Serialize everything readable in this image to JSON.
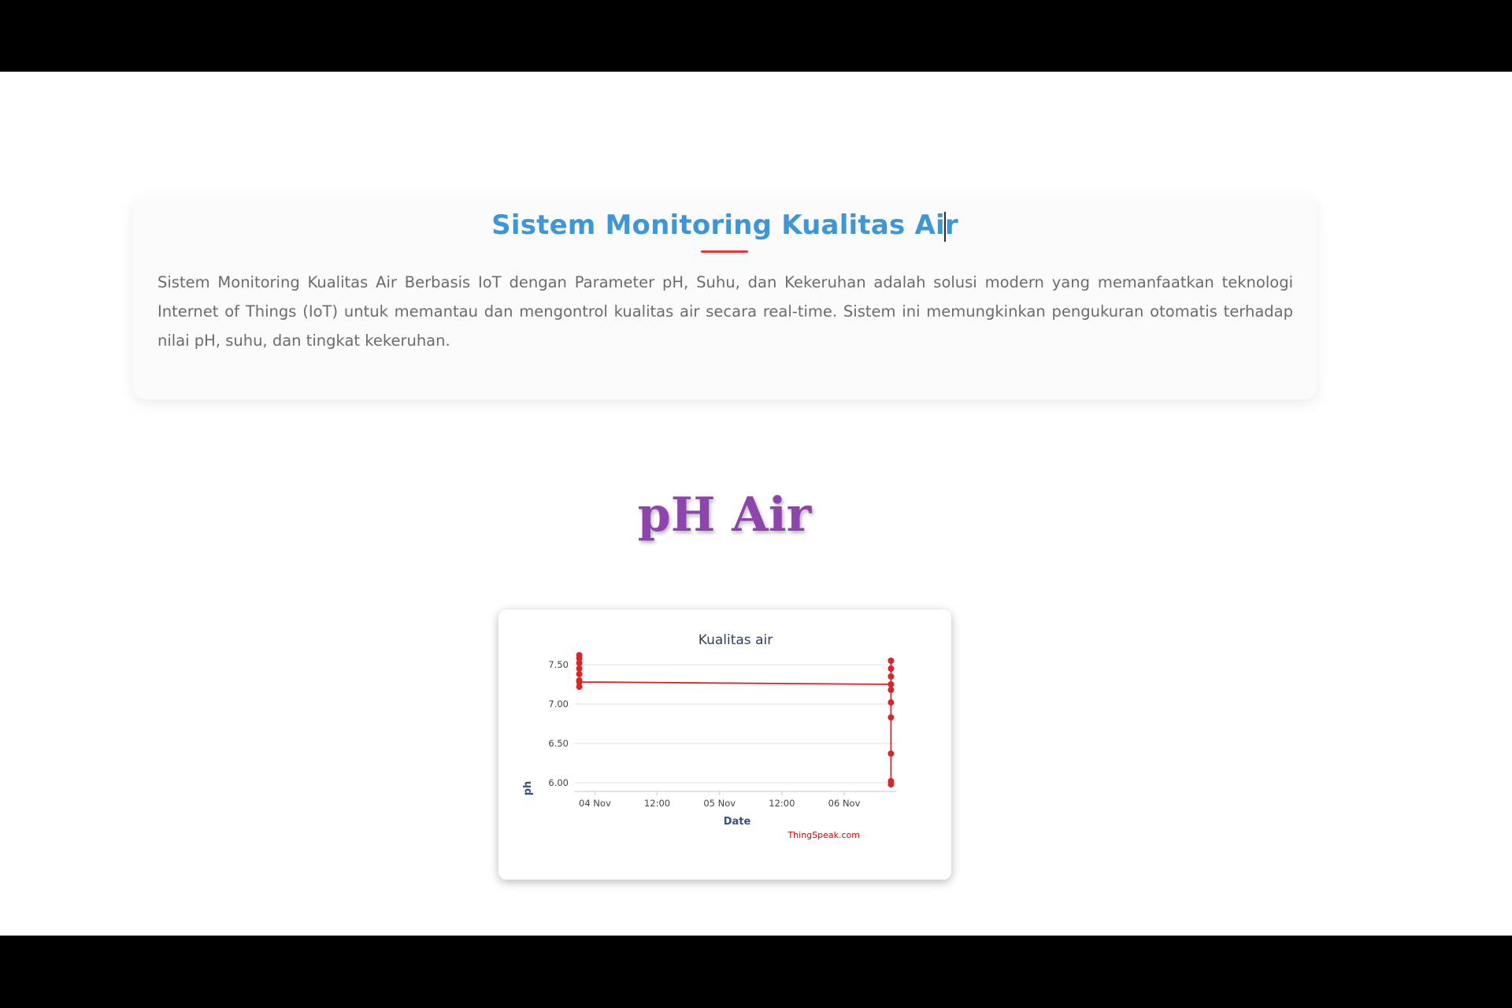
{
  "intro": {
    "title_part1": "Sistem Monitoring Kualitas Ai",
    "title_part2": "r",
    "description": "Sistem Monitoring Kualitas Air Berbasis IoT dengan Parameter pH, Suhu, dan Kekeruhan adalah solusi modern yang memanfaatkan teknologi Internet of Things (IoT) untuk memantau dan mengontrol kualitas air secara real-time. Sistem ini memungkinkan pengukuran otomatis terhadap nilai pH, suhu, dan tingkat kekeruhan."
  },
  "section": {
    "heading": "pH Air"
  },
  "colors": {
    "title_blue": "#3f96d7",
    "underline_red": "#e53935",
    "heading_purple": "#8e44ad",
    "series_red": "#d62728",
    "credit_red": "#d60000"
  },
  "chart_data": {
    "type": "line",
    "title": "Kualitas air",
    "xlabel": "Date",
    "ylabel": "ph",
    "credit": "ThingSpeak.com",
    "x_ticks": [
      "04 Nov",
      "12:00",
      "05 Nov",
      "12:00",
      "06 Nov"
    ],
    "y_ticks": [
      "6.00",
      "6.50",
      "7.00",
      "7.50"
    ],
    "ylim": [
      5.95,
      7.6
    ],
    "xlim": [
      "2023-11-03T20:00",
      "2023-11-06T10:00"
    ],
    "grid": true,
    "series": [
      {
        "points": [
          {
            "x": "2023-11-03T21:00",
            "y": 7.22
          },
          {
            "x": "2023-11-03T21:00",
            "y": 7.3
          },
          {
            "x": "2023-11-03T21:00",
            "y": 7.38
          },
          {
            "x": "2023-11-03T21:00",
            "y": 7.45
          },
          {
            "x": "2023-11-03T21:00",
            "y": 7.52
          },
          {
            "x": "2023-11-03T21:00",
            "y": 7.58
          },
          {
            "x": "2023-11-03T21:00",
            "y": 7.62
          },
          {
            "x": "2023-11-03T21:00",
            "y": 7.28
          },
          {
            "x": "2023-11-06T09:00",
            "y": 7.25
          },
          {
            "x": "2023-11-06T09:00",
            "y": 7.55
          },
          {
            "x": "2023-11-06T09:00",
            "y": 7.45
          },
          {
            "x": "2023-11-06T09:00",
            "y": 7.35
          },
          {
            "x": "2023-11-06T09:00",
            "y": 7.18
          },
          {
            "x": "2023-11-06T09:00",
            "y": 7.02
          },
          {
            "x": "2023-11-06T09:00",
            "y": 6.83
          },
          {
            "x": "2023-11-06T09:00",
            "y": 6.37
          },
          {
            "x": "2023-11-06T09:00",
            "y": 6.02
          },
          {
            "x": "2023-11-06T09:00",
            "y": 5.98
          }
        ]
      }
    ]
  }
}
